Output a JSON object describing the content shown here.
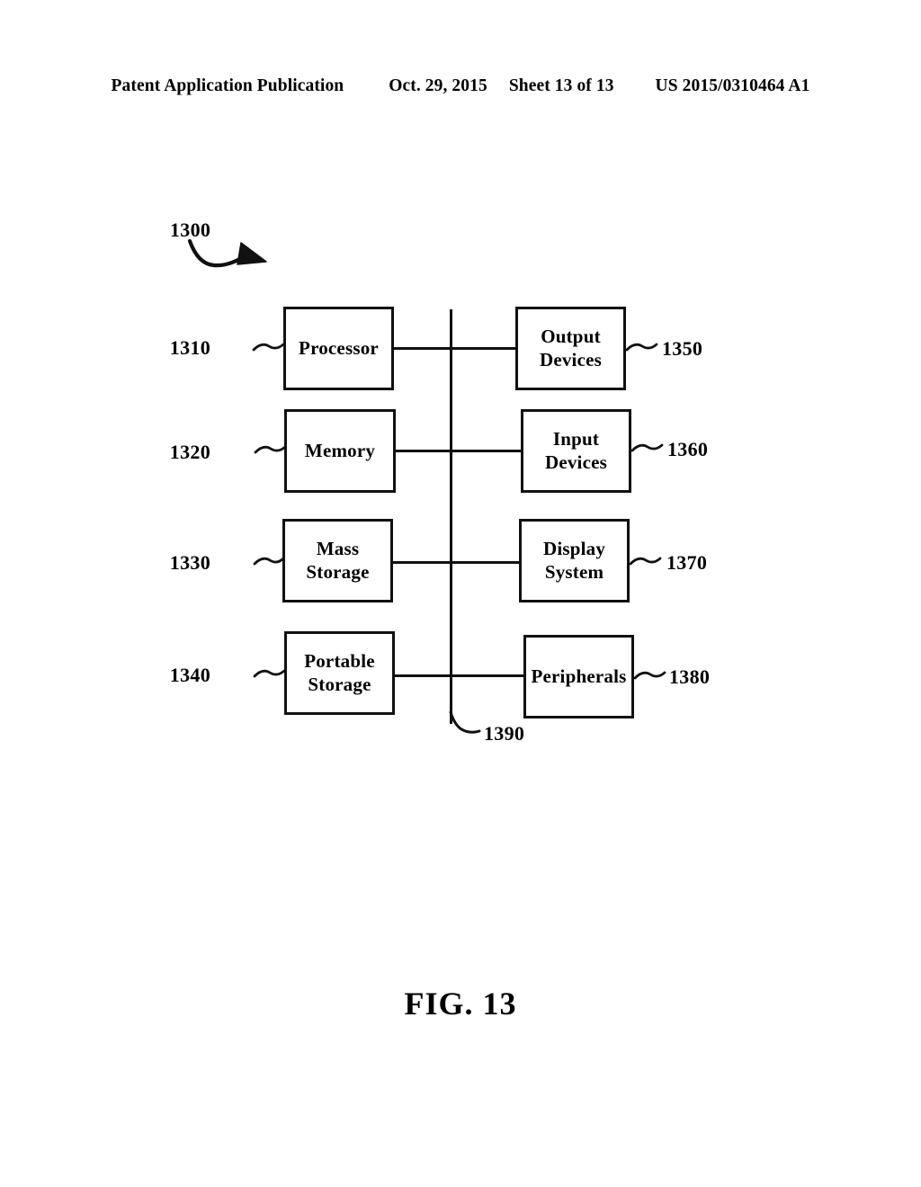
{
  "header": {
    "publication": "Patent Application Publication",
    "date": "Oct. 29, 2015",
    "sheet": "Sheet 13 of 13",
    "patent_number": "US 2015/0310464 A1"
  },
  "figure": {
    "caption": "FIG. 13",
    "system_ref": "1300",
    "bus_ref": "1390",
    "nodes": [
      {
        "ref": "1310",
        "label": "Processor",
        "side": "left"
      },
      {
        "ref": "1320",
        "label": "Memory",
        "side": "left"
      },
      {
        "ref": "1330",
        "label": "Mass\nStorage",
        "side": "left"
      },
      {
        "ref": "1340",
        "label": "Portable\nStorage",
        "side": "left"
      },
      {
        "ref": "1350",
        "label": "Output\nDevices",
        "side": "right"
      },
      {
        "ref": "1360",
        "label": "Input\nDevices",
        "side": "right"
      },
      {
        "ref": "1370",
        "label": "Display\nSystem",
        "side": "right"
      },
      {
        "ref": "1380",
        "label": "Peripherals",
        "side": "right"
      }
    ]
  },
  "colors": {
    "ink": "#111111",
    "paper": "#ffffff"
  }
}
